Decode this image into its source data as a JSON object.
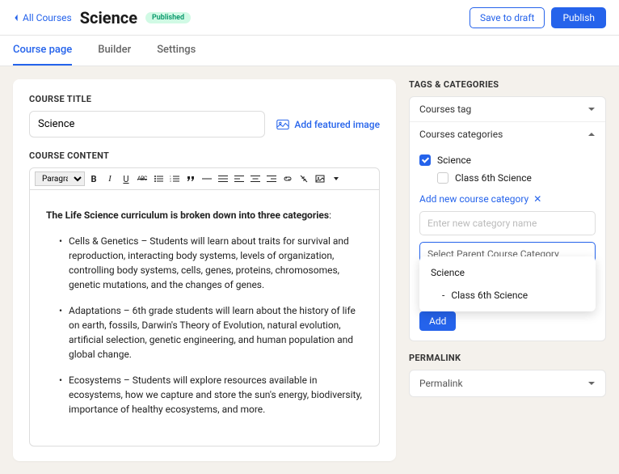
{
  "header": {
    "back_label": "All Courses",
    "title": "Science",
    "status": "Published",
    "save_draft": "Save to draft",
    "publish": "Publish"
  },
  "tabs": [
    {
      "label": "Course page",
      "active": true
    },
    {
      "label": "Builder",
      "active": false
    },
    {
      "label": "Settings",
      "active": false
    }
  ],
  "main": {
    "title_label": "COURSE TITLE",
    "title_value": "Science",
    "add_image": "Add featured image",
    "content_label": "COURSE CONTENT",
    "format_option": "Paragraph",
    "intro": "The Life Science curriculum is broken down into three categories",
    "bullets": [
      "Cells & Genetics – Students will learn about traits for survival and reproduction, interacting body systems, levels of organization, controlling body systems, cells, genes, proteins, chromosomes, genetic mutations, and the changes of genes.",
      "Adaptations – 6th grade students will learn about the history of life on earth, fossils, Darwin's Theory of Evolution, natural evolution, artificial selection, genetic engineering, and human population and global change.",
      "Ecosystems – Students will explore resources available in ecosystems, how we capture and store the sun's energy, biodiversity, importance of healthy ecosystems, and more."
    ]
  },
  "sidebar": {
    "tags_label": "TAGS & CATEGORIES",
    "tags_row": "Courses tag",
    "categories_row": "Courses categories",
    "categories": {
      "parent": "Science",
      "child": "Class 6th Science"
    },
    "add_category": "Add new course category",
    "new_category_placeholder": "Enter new category name",
    "parent_placeholder": "Select Parent Course Category",
    "dropdown": {
      "option1": "Science",
      "option2_prefix": "-",
      "option2": "Class 6th Science"
    },
    "add_btn": "Add",
    "permalink_label": "PERMALINK",
    "permalink_value": "Permalink"
  }
}
